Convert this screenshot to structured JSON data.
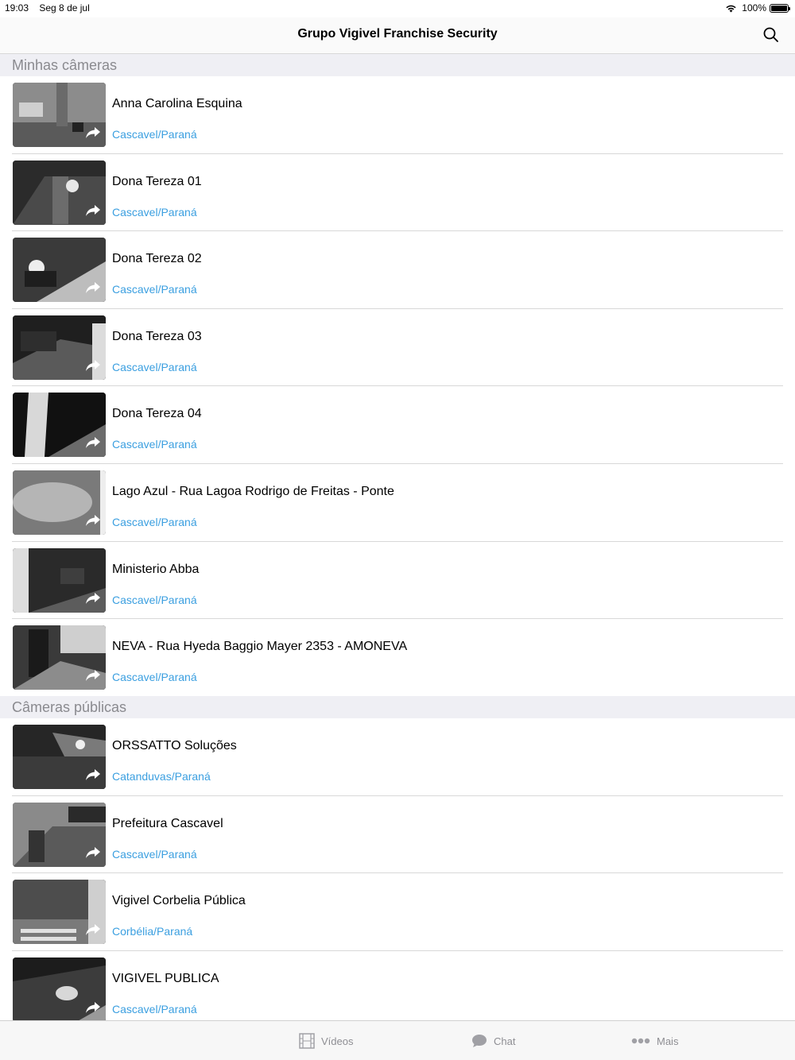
{
  "status": {
    "time": "19:03",
    "date": "Seg 8 de jul",
    "battery": "100%",
    "wifi_icon": "wifi-icon",
    "battery_icon": "battery-icon"
  },
  "nav": {
    "title": "Grupo Vigivel Franchise Security",
    "search_icon": "search-icon"
  },
  "sections": {
    "mine": "Minhas câmeras",
    "public": "Câmeras públicas"
  },
  "my_cameras": [
    {
      "name": "Anna Carolina Esquina",
      "location": "Cascavel/Paraná"
    },
    {
      "name": "Dona Tereza 01",
      "location": "Cascavel/Paraná"
    },
    {
      "name": "Dona Tereza 02",
      "location": "Cascavel/Paraná"
    },
    {
      "name": "Dona Tereza 03",
      "location": "Cascavel/Paraná"
    },
    {
      "name": "Dona Tereza 04",
      "location": "Cascavel/Paraná"
    },
    {
      "name": "Lago Azul - Rua Lagoa Rodrigo de Freitas - Ponte",
      "location": "Cascavel/Paraná"
    },
    {
      "name": "Ministerio Abba",
      "location": "Cascavel/Paraná"
    },
    {
      "name": "NEVA - Rua Hyeda Baggio Mayer 2353 - AMONEVA",
      "location": "Cascavel/Paraná"
    }
  ],
  "public_cameras": [
    {
      "name": "ORSSATTO Soluções",
      "location": "Catanduvas/Paraná"
    },
    {
      "name": "Prefeitura Cascavel",
      "location": "Cascavel/Paraná"
    },
    {
      "name": "Vigivel Corbelia Pública",
      "location": "Corbélia/Paraná"
    },
    {
      "name": "VIGIVEL PUBLICA",
      "location": "Cascavel/Paraná"
    }
  ],
  "tabs": {
    "videos": "Vídeos",
    "chat": "Chat",
    "more": "Mais"
  },
  "colors": {
    "accent": "#3b9fe0",
    "section_bg": "#efeff4",
    "tab_gray": "#8e8e93"
  }
}
